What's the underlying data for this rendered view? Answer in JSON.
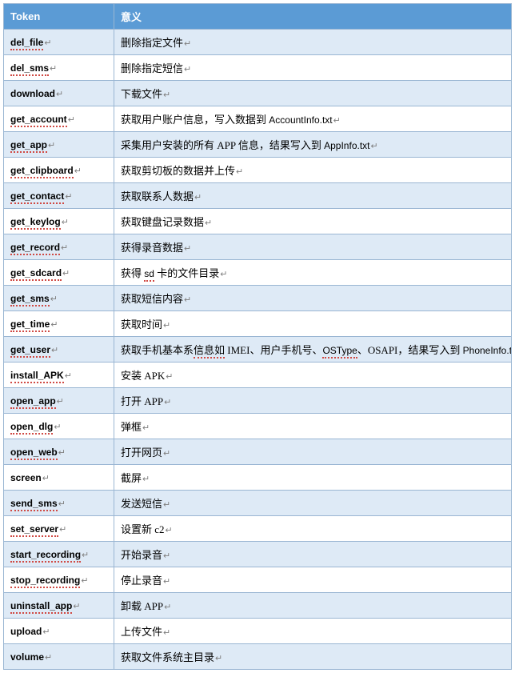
{
  "headers": {
    "token": "Token",
    "meaning": "意义"
  },
  "rows": [
    {
      "token": "del_file",
      "sq": true,
      "meaning_plain": "删除指定文件"
    },
    {
      "token": "del_sms",
      "sq": true,
      "meaning_plain": "删除指定短信"
    },
    {
      "token": "download",
      "sq": false,
      "meaning_plain": "下载文件"
    },
    {
      "token": "get_account",
      "sq": true,
      "meaning_html": "获取用户账户信息，写入数据到 <span class=\"latin\">AccountInfo.txt</span>"
    },
    {
      "token": "get_app",
      "sq": true,
      "meaning_html": "采集用户安装的所有 APP 信息，结果写入到 <span class=\"latin\">AppInfo.txt</span>"
    },
    {
      "token": "get_clipboard",
      "sq": true,
      "meaning_plain": "获取剪切板的数据并上传"
    },
    {
      "token": "get_contact",
      "sq": true,
      "meaning_plain": "获取联系人数据"
    },
    {
      "token": "get_keylog",
      "sq": true,
      "meaning_plain": "获取键盘记录数据"
    },
    {
      "token": "get_record",
      "sq": true,
      "meaning_plain": "获得录音数据"
    },
    {
      "token": "get_sdcard",
      "sq": true,
      "meaning_html": "获得 <span class=\"red-sq latin\">sd</span> 卡的文件目录"
    },
    {
      "token": "get_sms",
      "sq": true,
      "meaning_plain": "获取短信内容"
    },
    {
      "token": "get_time",
      "sq": true,
      "meaning_plain": "获取时间"
    },
    {
      "token": "get_user",
      "sq": true,
      "meaning_html": "获取手机基本系<span class=\"red-sq\">信息如</span> IMEI、用户手机号、<span class=\"red-sq latin\">OSType</span>、OSAPI，结果写入到 <span class=\"latin\">PhoneInfo.txt</span>"
    },
    {
      "token": "install_APK",
      "sq": true,
      "meaning_plain": "安装 APK"
    },
    {
      "token": "open_app",
      "sq": true,
      "meaning_plain": "打开 APP"
    },
    {
      "token": "open_dlg",
      "sq": true,
      "meaning_plain": "弹框"
    },
    {
      "token": "open_web",
      "sq": true,
      "meaning_plain": "打开网页"
    },
    {
      "token": "screen",
      "sq": false,
      "meaning_plain": "截屏"
    },
    {
      "token": "send_sms",
      "sq": true,
      "meaning_plain": "发送短信"
    },
    {
      "token": "set_server",
      "sq": true,
      "meaning_plain": "设置新 c2"
    },
    {
      "token": "start_recording",
      "sq": true,
      "meaning_plain": "开始录音"
    },
    {
      "token": "stop_recording",
      "sq": true,
      "meaning_plain": "停止录音"
    },
    {
      "token": "uninstall_app",
      "sq": true,
      "meaning_plain": "卸载 APP"
    },
    {
      "token": "upload",
      "sq": false,
      "meaning_plain": "上传文件"
    },
    {
      "token": "volume",
      "sq": false,
      "meaning_plain": "获取文件系统主目录"
    }
  ]
}
